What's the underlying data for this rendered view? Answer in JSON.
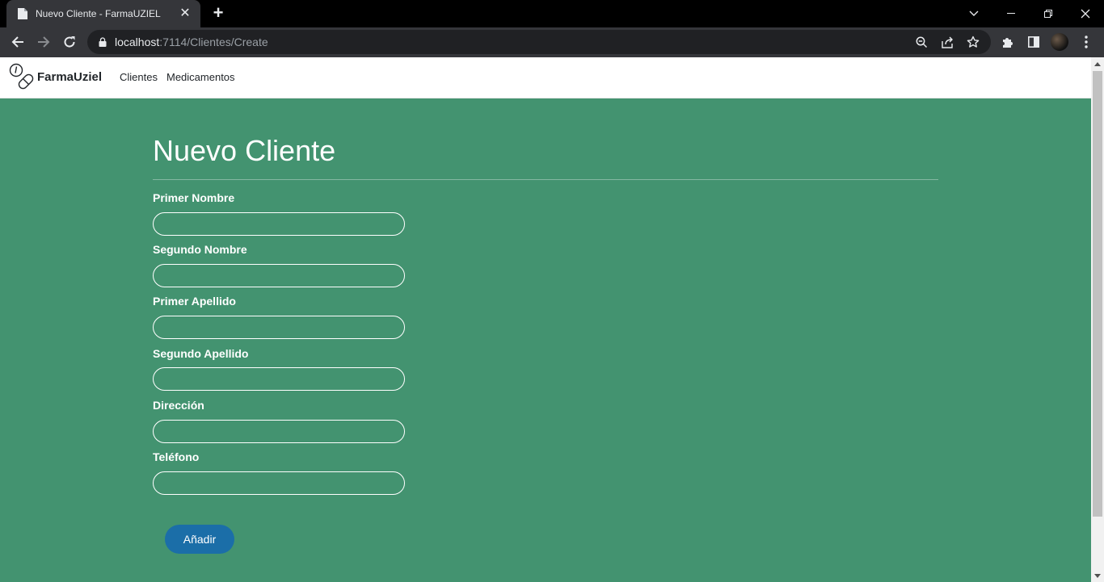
{
  "browser": {
    "tab_title": "Nuevo Cliente - FarmaUZIEL",
    "tab_close": "✕",
    "new_tab": "+",
    "url_host": "localhost",
    "url_path": ":7114/Clientes/Create"
  },
  "navbar": {
    "brand": "FarmaUziel",
    "links": [
      "Clientes",
      "Medicamentos"
    ]
  },
  "form": {
    "title": "Nuevo Cliente",
    "fields": [
      {
        "label": "Primer Nombre",
        "value": ""
      },
      {
        "label": "Segundo Nombre",
        "value": ""
      },
      {
        "label": "Primer Apellido",
        "value": ""
      },
      {
        "label": "Segundo Apellido",
        "value": ""
      },
      {
        "label": "Dirección",
        "value": ""
      },
      {
        "label": "Teléfono",
        "value": ""
      }
    ],
    "submit_label": "Añadir"
  },
  "colors": {
    "page_background": "#439370",
    "submit_button": "#1b6ea8",
    "navbar_background": "#ffffff"
  },
  "icons": {
    "tab_favicon": "document-icon",
    "back": "arrow-left-icon",
    "forward": "arrow-right-icon",
    "reload": "reload-icon",
    "lock": "lock-icon",
    "zoom": "zoom-out-icon",
    "share": "share-icon",
    "bookmark": "star-icon",
    "extensions": "puzzle-icon",
    "side_panel": "side-panel-icon",
    "menu": "kebab-menu-icon",
    "brand_logo": "pill-icon"
  }
}
